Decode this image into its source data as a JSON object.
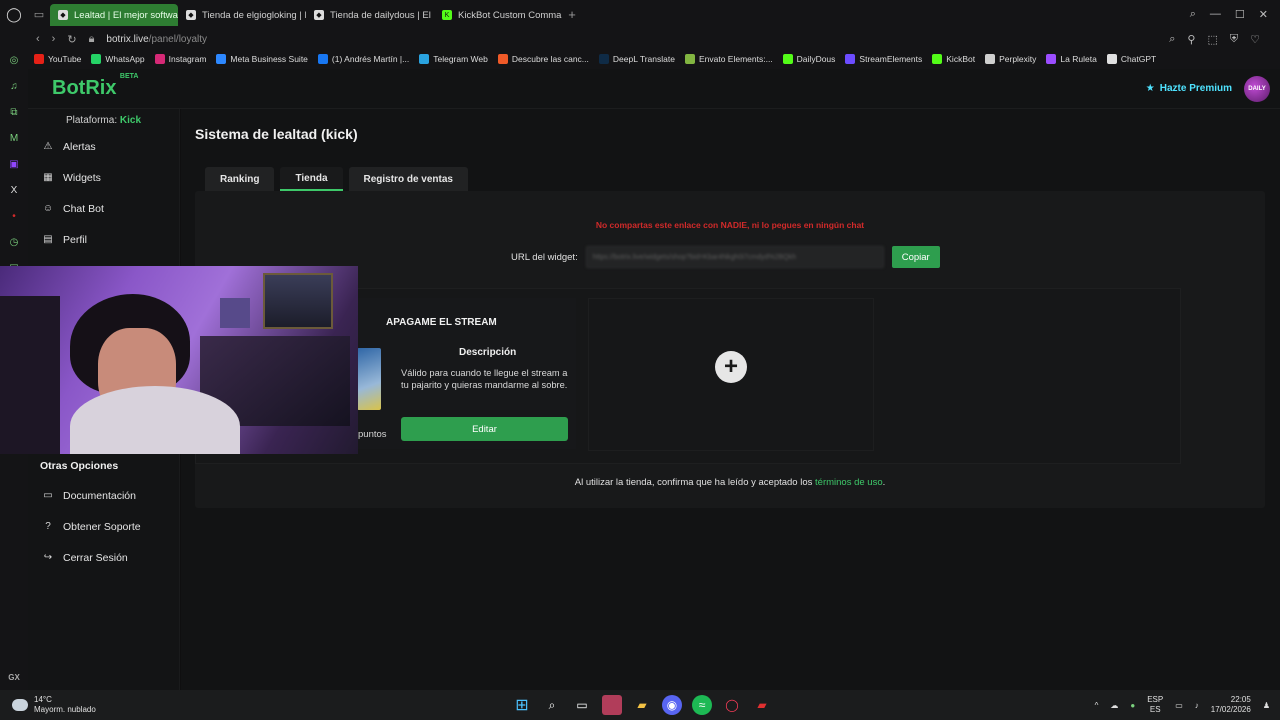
{
  "browser": {
    "tabs": [
      {
        "label": "Lealtad | El mejor softwar",
        "active": true
      },
      {
        "label": "Tienda de elgiogloking | E",
        "active": false
      },
      {
        "label": "Tienda de dailydous | El m",
        "active": false
      },
      {
        "label": "KickBot Custom Comman",
        "active": false
      }
    ],
    "url_host": "botrix.live",
    "url_path": "/panel/loyalty",
    "bookmarks": [
      {
        "label": "YouTube",
        "color": "#e62117"
      },
      {
        "label": "WhatsApp",
        "color": "#25d366"
      },
      {
        "label": "Instagram",
        "color": "#d62976"
      },
      {
        "label": "Meta Business Suite",
        "color": "#2d88ff"
      },
      {
        "label": "(1) Andrés Martín |...",
        "color": "#1877f2"
      },
      {
        "label": "Telegram Web",
        "color": "#2aa3e0"
      },
      {
        "label": "Descubre las canc...",
        "color": "#f05a28"
      },
      {
        "label": "DeepL Translate",
        "color": "#0f2b46"
      },
      {
        "label": "Envato Elements:...",
        "color": "#82b541"
      },
      {
        "label": "DailyDous",
        "color": "#53fc18"
      },
      {
        "label": "StreamElements",
        "color": "#6c4cff"
      },
      {
        "label": "KickBot",
        "color": "#53fc18"
      },
      {
        "label": "Perplexity",
        "color": "#cfcfcf"
      },
      {
        "label": "La Ruleta",
        "color": "#9b4dff"
      },
      {
        "label": "ChatGPT",
        "color": "#e0e0e0"
      }
    ]
  },
  "header": {
    "logo": "BotRix",
    "beta": "BETA",
    "premium_label": "Hazte Premium",
    "avatar_text": "DAILY"
  },
  "sidebar": {
    "platform_label": "Plataforma:",
    "platform_value": "Kick",
    "items": [
      {
        "label": "Alertas",
        "icon": "⚠"
      },
      {
        "label": "Widgets",
        "icon": "▦"
      },
      {
        "label": "Chat Bot",
        "icon": "☺"
      },
      {
        "label": "Perfil",
        "icon": "▤"
      }
    ],
    "other_title": "Otras Opciones",
    "other_items": [
      {
        "label": "Documentación",
        "icon": "▭"
      },
      {
        "label": "Obtener Soporte",
        "icon": "?"
      },
      {
        "label": "Cerrar Sesión",
        "icon": "↪"
      }
    ]
  },
  "main": {
    "title": "Sistema de lealtad (kick)",
    "tabs": [
      {
        "label": "Ranking",
        "active": false
      },
      {
        "label": "Tienda",
        "active": true
      },
      {
        "label": "Registro de ventas",
        "active": false
      }
    ],
    "warning": "No compartas este enlace con NADIE, ni lo pegues en ningún chat",
    "url_label": "URL del widget:",
    "url_value": "https://botrix.live/widgets/shop?bid=Kbar4Nkgh0i7cmdyd%2BQkh",
    "copy_label": "Copiar",
    "item": {
      "title": "APAGAME EL STREAM",
      "points": "puntos",
      "desc_title": "Descripción",
      "desc_text": "Válido para cuando te llegue el stream a tu pajarito y quieras mandarme al sobre.",
      "edit_label": "Editar"
    },
    "terms_prefix": "Al utilizar la tienda, confirma que ha leído y aceptado los",
    "terms_link": "términos de uso",
    "terms_suffix": "."
  },
  "taskbar": {
    "temp": "14°C",
    "weather": "Mayorm. nublado",
    "lang_top": "ESP",
    "lang_bottom": "ES",
    "time": "22:05",
    "date": "17/02/2026"
  },
  "colors": {
    "accent": "#3ec96a",
    "button": "#2e9e4e",
    "warning": "#d12a2a",
    "premium": "#4fe3ff"
  }
}
